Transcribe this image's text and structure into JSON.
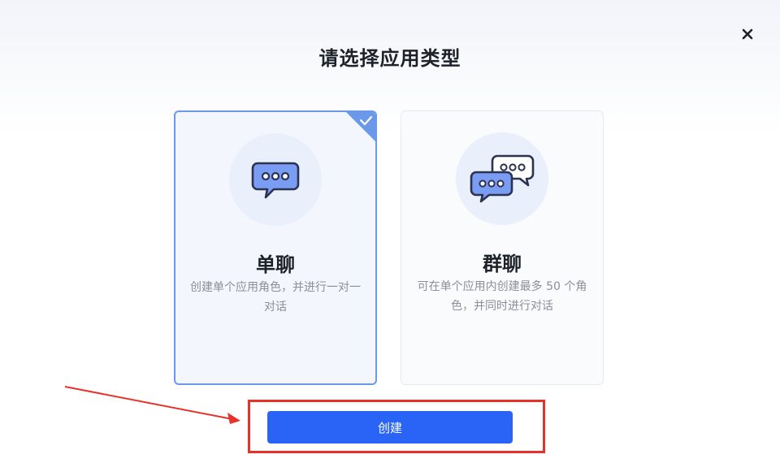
{
  "dialog": {
    "title": "请选择应用类型",
    "close_icon": "close-icon"
  },
  "cards": [
    {
      "id": "single",
      "title": "单聊",
      "description": "创建单个应用角色，并进行一对一对话",
      "icon": "single-chat-bubble-icon",
      "selected": true
    },
    {
      "id": "group",
      "title": "群聊",
      "description": "可在单个应用内创建最多 50 个角色，并同时进行对话",
      "icon": "group-chat-bubbles-icon",
      "selected": false
    }
  ],
  "actions": {
    "create_label": "创建"
  },
  "annotation": {
    "highlight_color": "#e8312a",
    "arrow_color": "#e8312a"
  },
  "colors": {
    "primary": "#2a64f6",
    "selected_border": "#6c98ea",
    "bubble_fill": "#7a9cf2",
    "bubble_stroke": "#2b3350"
  }
}
